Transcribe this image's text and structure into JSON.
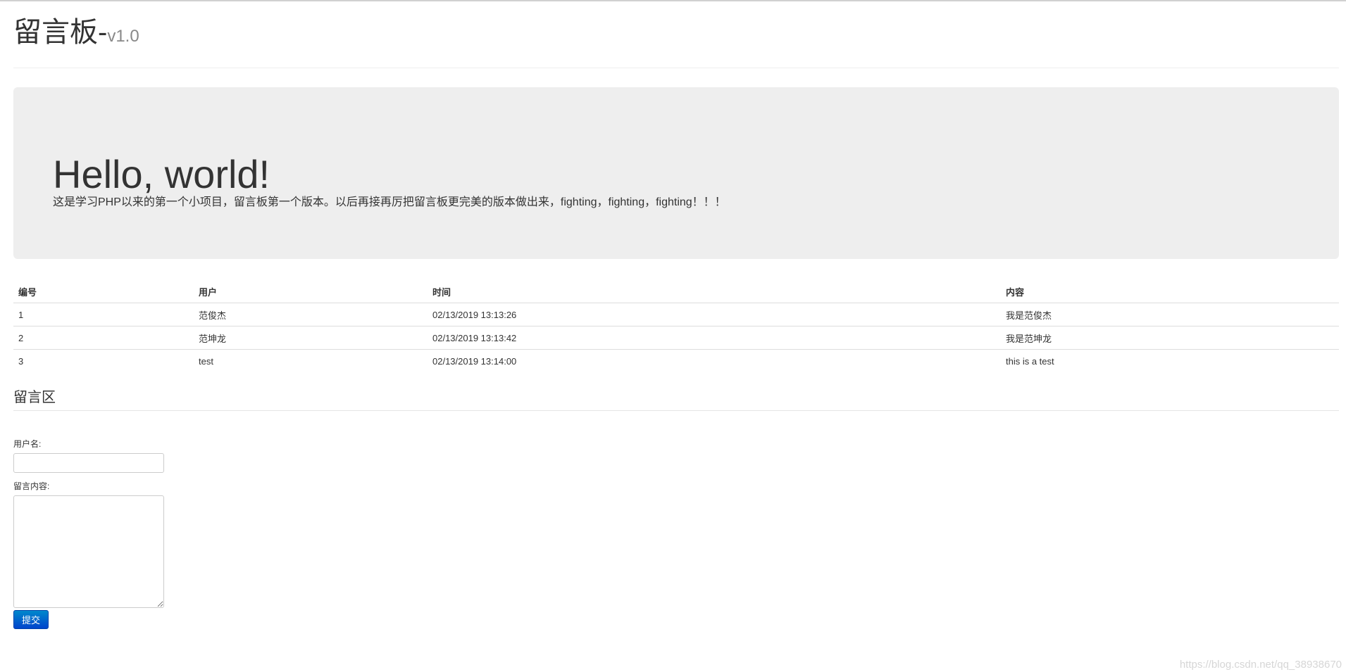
{
  "header": {
    "title": "留言板-",
    "version": "v1.0"
  },
  "jumbotron": {
    "heading": "Hello, world!",
    "text": "这是学习PHP以来的第一个小项目，留言板第一个版本。以后再接再厉把留言板更完美的版本做出来，fighting，fighting，fighting！！！"
  },
  "table": {
    "headers": [
      "编号",
      "用户",
      "时间",
      "内容"
    ],
    "rows": [
      [
        "1",
        "范俊杰",
        "02/13/2019 13:13:26",
        "我是范俊杰"
      ],
      [
        "2",
        "范坤龙",
        "02/13/2019 13:13:42",
        "我是范坤龙"
      ],
      [
        "3",
        "test",
        "02/13/2019 13:14:00",
        "this is a test"
      ]
    ]
  },
  "form": {
    "section_title": "留言区",
    "username_label": "用户名:",
    "username_value": "",
    "content_label": "留言内容:",
    "content_value": "",
    "submit_label": "提交"
  },
  "watermark": "https://blog.csdn.net/qq_38938670"
}
